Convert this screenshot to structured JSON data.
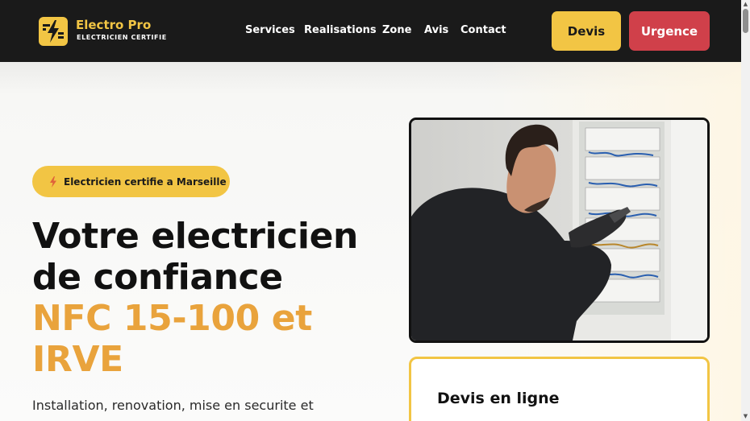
{
  "brand": {
    "name": "Electro Pro",
    "tagline": "ELECTRICIEN CERTIFIE",
    "logo_icon": "lightning-bolt-icon"
  },
  "nav": {
    "items": [
      "Services",
      "Realisations",
      "Zone",
      "Avis",
      "Contact"
    ]
  },
  "actions": {
    "devis_label": "Devis",
    "urgence_label": "Urgence"
  },
  "hero": {
    "badge_icon": "lightning-icon",
    "badge_text": "Electricien certifie a Marseille",
    "title_line1": "Votre electricien",
    "title_line2": "de confiance",
    "title_accent1": "NFC 15-100 et",
    "title_accent2": "IRVE",
    "subtitle": "Installation, renovation, mise en securite et"
  },
  "quote_card": {
    "title": "Devis en ligne"
  },
  "colors": {
    "yellow": "#f2c544",
    "red": "#d0404a",
    "dark": "#1a1a1a",
    "accent_orange": "#e9a33c"
  }
}
